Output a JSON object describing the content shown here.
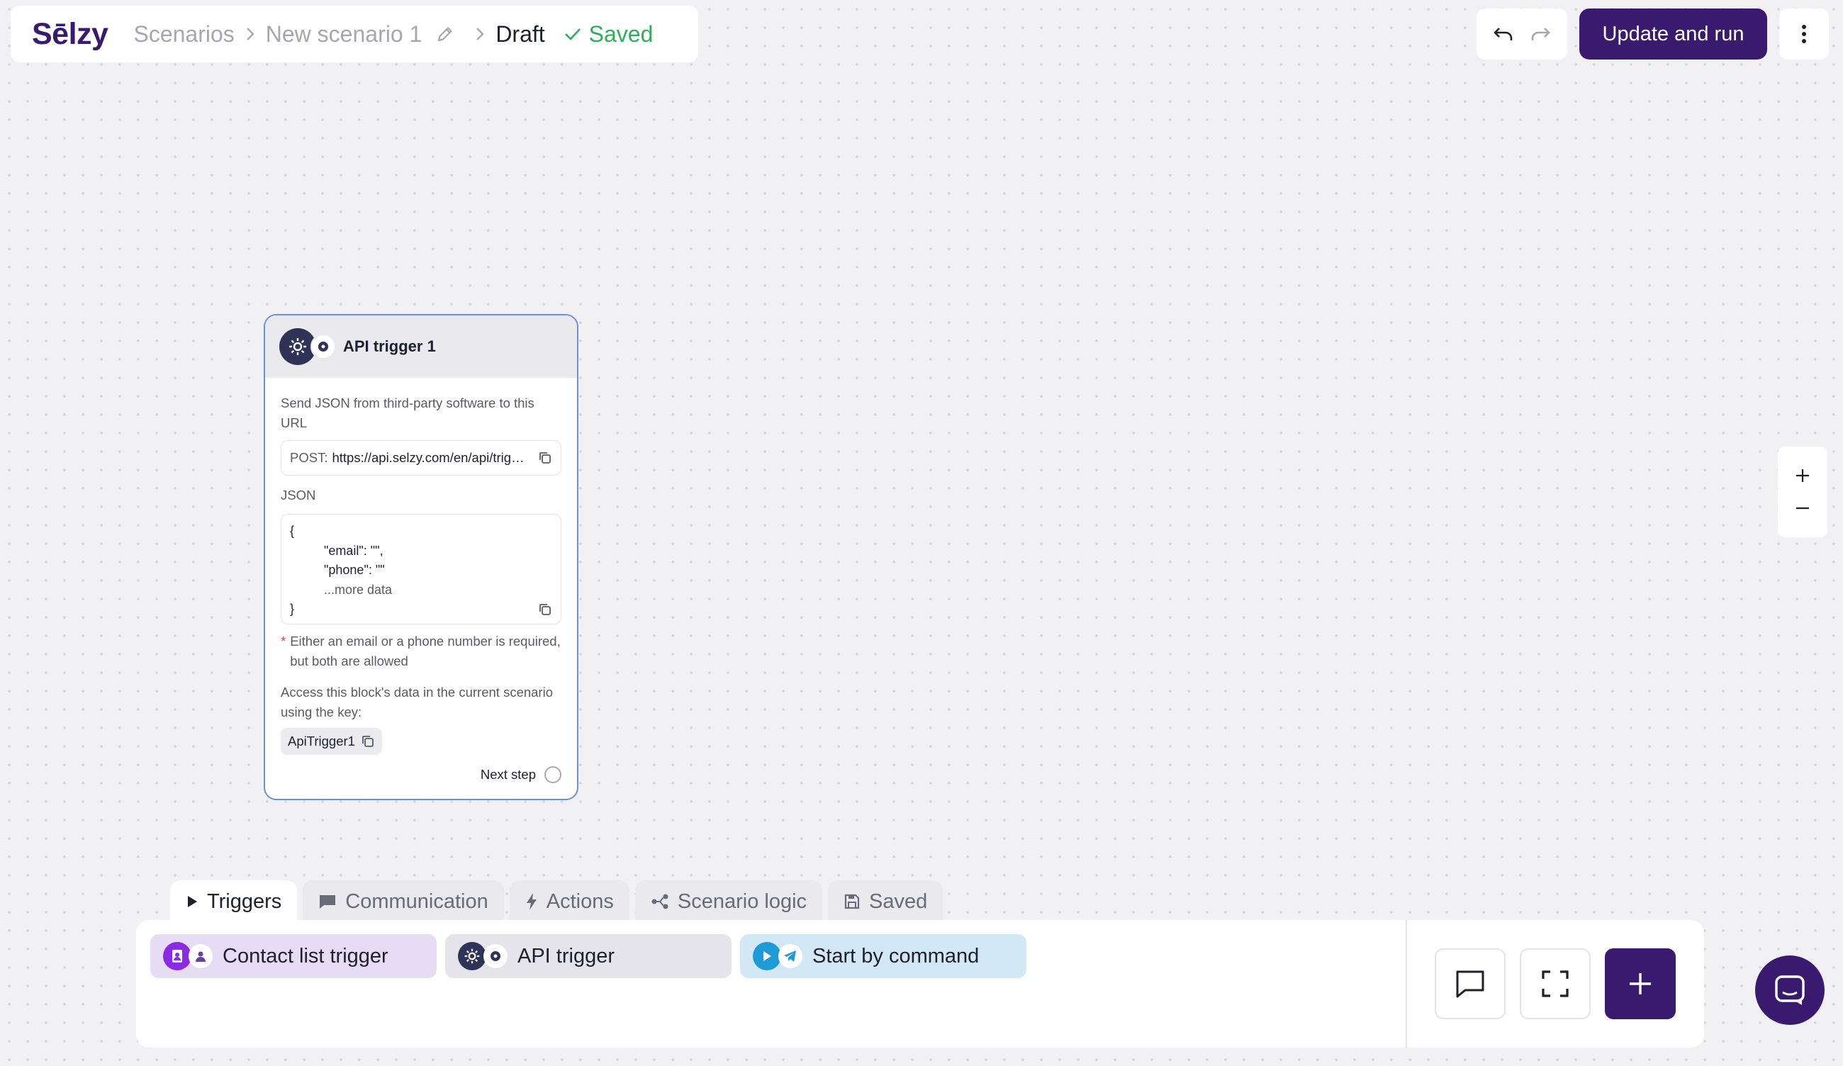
{
  "header": {
    "logo": "Sēlzy",
    "breadcrumbs": [
      "Scenarios",
      "New scenario 1",
      "Draft"
    ],
    "status": "Saved",
    "run_label": "Update and run"
  },
  "node": {
    "title": "API trigger 1",
    "description": "Send JSON from third-party software to this URL",
    "method": "POST:",
    "url": "https://api.selzy.com/en/api/trig…",
    "json_label": "JSON",
    "json_lines": [
      "{",
      "\"email\": \"\",",
      "\"phone\": \"\"",
      "...more data",
      "}"
    ],
    "note_star": "*",
    "note": "Either an email or a phone number is required, but both are allowed",
    "access_text": "Access this block's data in the current scenario using the key:",
    "key": "ApiTrigger1",
    "next_step": "Next step"
  },
  "bottom": {
    "tabs": [
      "Triggers",
      "Communication",
      "Actions",
      "Scenario logic",
      "Saved"
    ],
    "active_tab": "Triggers",
    "items": [
      "Contact list trigger",
      "API trigger",
      "Start by command"
    ]
  },
  "colors": {
    "brand": "#3a1a6e",
    "saved_green": "#2fae5a",
    "contact_chip": "#e6dcf3",
    "api_chip": "#e4e4ea",
    "command_chip": "#d3e8f5"
  }
}
